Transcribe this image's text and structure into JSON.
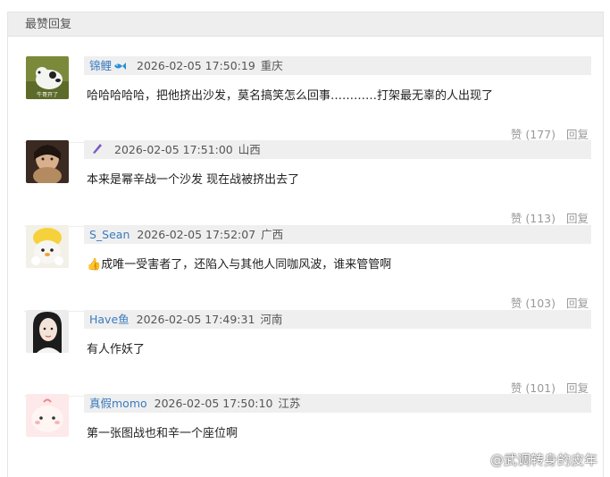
{
  "section": {
    "title": "最赞回复"
  },
  "comments": [
    {
      "user": "锦鲤",
      "badge": "fish-badge-icon",
      "time": "2026-02-05 17:50:19",
      "location": "重庆",
      "text": "哈哈哈哈哈，把他挤出沙发，莫名搞笑怎么回事…………打架最无辜的人出现了",
      "likes": "赞 (177)",
      "reply": "回复"
    },
    {
      "user": "",
      "badge": "pen-badge-icon",
      "time": "2026-02-05 17:51:00",
      "location": "山西",
      "text": "本来是幂辛战一个沙发 现在战被挤出去了",
      "likes": "赞 (113)",
      "reply": "回复"
    },
    {
      "user": "S_Sean",
      "badge": "",
      "time": "2026-02-05 17:52:07",
      "location": "广西",
      "text": "成唯一受害者了，还陷入与其他人同咖风波，谁来管管啊",
      "emoji": "👍",
      "likes": "赞 (103)",
      "reply": "回复"
    },
    {
      "user": "Have鱼",
      "badge": "",
      "time": "2026-02-05 17:49:31",
      "location": "河南",
      "text": "有人作妖了",
      "likes": "赞 (101)",
      "reply": "回复"
    },
    {
      "user": "真假momo",
      "badge": "",
      "time": "2026-02-05 17:50:10",
      "location": "江苏",
      "text": "第一张图战也和辛一个座位啊",
      "likes": "",
      "reply": ""
    }
  ],
  "watermark": {
    "text": "@武调转身的皮年"
  },
  "colors": {
    "username": "#3b7bbf",
    "header_bg": "#eeeeee",
    "meta_bg": "#efefef",
    "action": "#999999"
  }
}
